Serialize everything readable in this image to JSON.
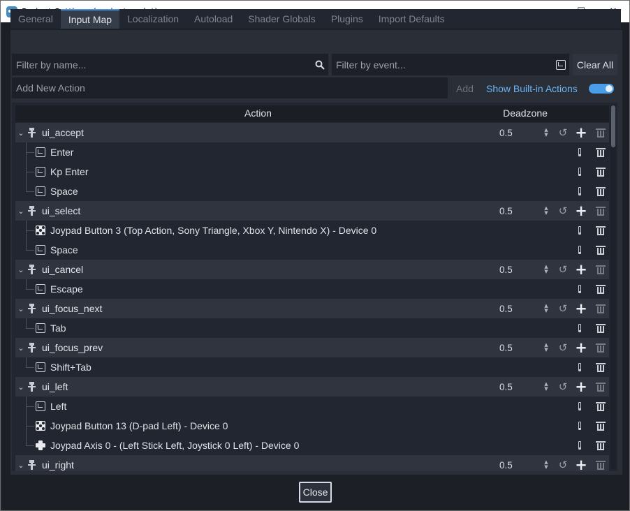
{
  "window": {
    "title": "Project Settings (project.godot)",
    "minimize": "—",
    "maximize": "☐",
    "close": "✕"
  },
  "tabs": [
    {
      "label": "General",
      "active": false
    },
    {
      "label": "Input Map",
      "active": true
    },
    {
      "label": "Localization",
      "active": false
    },
    {
      "label": "Autoload",
      "active": false
    },
    {
      "label": "Shader Globals",
      "active": false
    },
    {
      "label": "Plugins",
      "active": false
    },
    {
      "label": "Import Defaults",
      "active": false
    }
  ],
  "filters": {
    "name_placeholder": "Filter by name...",
    "event_placeholder": "Filter by event...",
    "clear_all": "Clear All"
  },
  "add_action": {
    "placeholder": "Add New Action",
    "add_label": "Add",
    "show_builtin_label": "Show Built-in Actions",
    "show_builtin_on": true
  },
  "table": {
    "col_action": "Action",
    "col_deadzone": "Deadzone"
  },
  "actions": [
    {
      "name": "ui_accept",
      "deadzone": "0.5",
      "events": [
        {
          "type": "key",
          "label": "Enter"
        },
        {
          "type": "key",
          "label": "Kp Enter"
        },
        {
          "type": "key",
          "label": "Space"
        }
      ]
    },
    {
      "name": "ui_select",
      "deadzone": "0.5",
      "events": [
        {
          "type": "joy-button",
          "label": "Joypad Button 3 (Top Action, Sony Triangle, Xbox Y, Nintendo X) - Device 0"
        },
        {
          "type": "key",
          "label": "Space"
        }
      ]
    },
    {
      "name": "ui_cancel",
      "deadzone": "0.5",
      "events": [
        {
          "type": "key",
          "label": "Escape"
        }
      ]
    },
    {
      "name": "ui_focus_next",
      "deadzone": "0.5",
      "events": [
        {
          "type": "key",
          "label": "Tab"
        }
      ]
    },
    {
      "name": "ui_focus_prev",
      "deadzone": "0.5",
      "events": [
        {
          "type": "key",
          "label": "Shift+Tab"
        }
      ]
    },
    {
      "name": "ui_left",
      "deadzone": "0.5",
      "events": [
        {
          "type": "key",
          "label": "Left"
        },
        {
          "type": "joy-button",
          "label": "Joypad Button 13 (D-pad Left) - Device 0"
        },
        {
          "type": "joy-axis",
          "label": "Joypad Axis 0 - (Left Stick Left, Joystick 0 Left) - Device 0"
        }
      ]
    },
    {
      "name": "ui_right",
      "deadzone": "0.5",
      "events": []
    }
  ],
  "footer": {
    "close_label": "Close"
  }
}
